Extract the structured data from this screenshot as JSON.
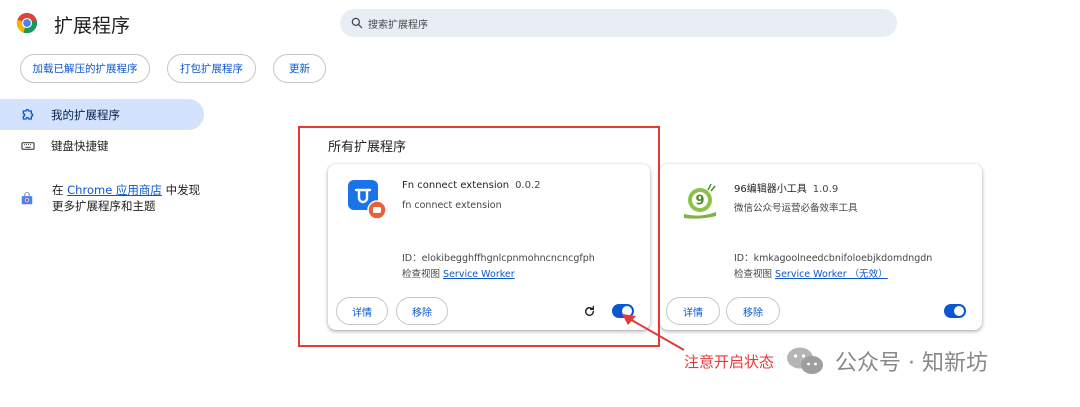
{
  "header": {
    "title": "扩展程序"
  },
  "search": {
    "placeholder": "搜索扩展程序"
  },
  "toolbar": {
    "load_unpacked": "加载已解压的扩展程序",
    "pack": "打包扩展程序",
    "update": "更新"
  },
  "sidebar": {
    "items": [
      {
        "label": "我的扩展程序",
        "icon": "puzzle-icon"
      },
      {
        "label": "键盘快捷键",
        "icon": "keyboard-icon"
      }
    ],
    "store": {
      "pre": "在 ",
      "link": "Chrome 应用商店",
      "post": " 中发现更多扩展程序和主题"
    }
  },
  "main": {
    "section_title": "所有扩展程序",
    "extensions": [
      {
        "name": "Fn connect extension",
        "version": "0.0.2",
        "description": "fn connect extension",
        "id": "ID：elokibegghffhgnlcpnmohncncncgfph",
        "inspect_label": "检查视图",
        "inspect_link": "Service Worker",
        "details": "详情",
        "remove": "移除",
        "enabled": true
      },
      {
        "name": "96编辑器小工具",
        "version": "1.0.9",
        "description": "微信公众号运营必备效率工具",
        "id": "ID：kmkagoolneedcbnifoloebjkdomdngdn",
        "inspect_label": "检查视图",
        "inspect_link": "Service Worker （无效）",
        "details": "详情",
        "remove": "移除",
        "enabled": true
      }
    ]
  },
  "annotation": {
    "text": "注意开启状态"
  },
  "watermark": {
    "text": "公众号 · 知新坊"
  },
  "colors": {
    "accent": "#0b57d0",
    "annotation": "#e53935",
    "nav_active": "#d3e3fd"
  }
}
